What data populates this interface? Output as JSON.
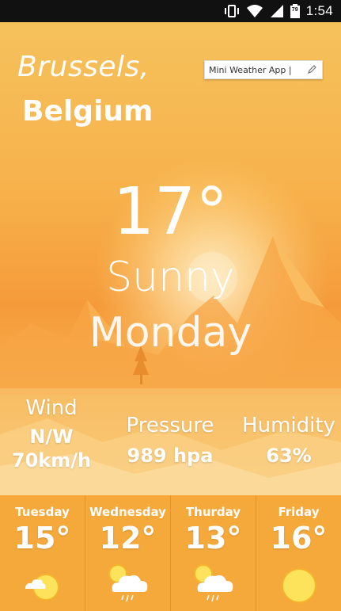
{
  "status_bar": {
    "time": "1:54",
    "battery_level": "79"
  },
  "location": {
    "city": "Brussels,",
    "country": "Belgium"
  },
  "app_field": {
    "text": "Mini Weather App |"
  },
  "current": {
    "temperature": "17°",
    "condition": "Sunny",
    "day": "Monday"
  },
  "stats": {
    "wind": {
      "label": "Wind",
      "direction": "N/W",
      "speed": "70km/h"
    },
    "pressure": {
      "label": "Pressure",
      "value": "989 hpa"
    },
    "humidity": {
      "label": "Humidity",
      "value": "63%"
    }
  },
  "forecast": [
    {
      "day": "Tuesday",
      "temp": "15°",
      "icon": "partly-cloudy-icon"
    },
    {
      "day": "Wednesday",
      "temp": "12°",
      "icon": "rain-cloud-icon"
    },
    {
      "day": "Thurday",
      "temp": "13°",
      "icon": "rain-cloud-icon"
    },
    {
      "day": "Friday",
      "temp": "16°",
      "icon": "sun-icon"
    }
  ],
  "colors": {
    "scene_top": "#f6c15b",
    "scene_mid": "#f59a3a",
    "forecast_bg": "#f6a93b",
    "sun": "#fde25c"
  }
}
